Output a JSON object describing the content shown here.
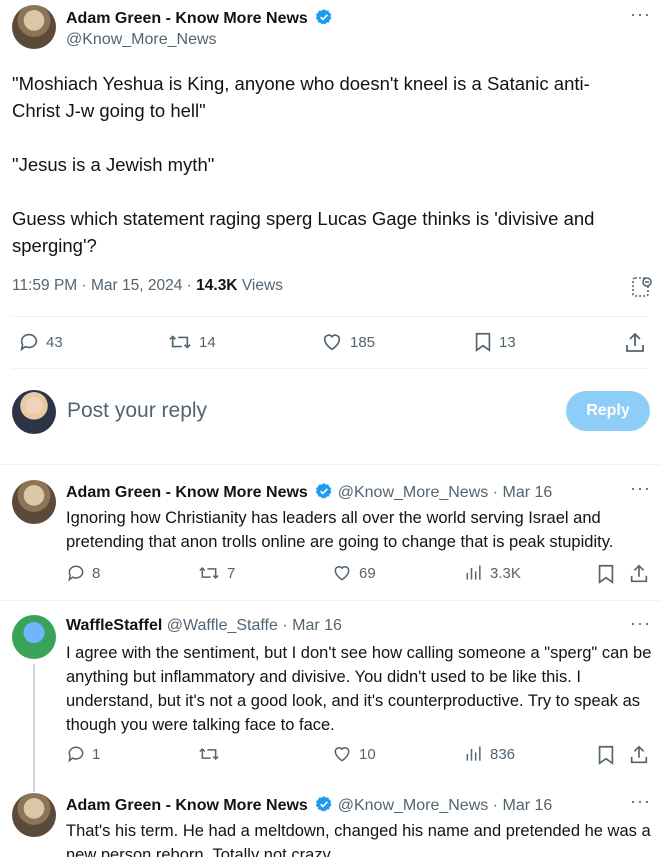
{
  "main_tweet": {
    "author_name": "Adam Green - Know More News",
    "handle": "@Know_More_News",
    "paragraphs": [
      "\"Moshiach Yeshua is King, anyone who doesn't kneel is a Satanic anti-Christ J-w going to hell\"",
      "\"Jesus is a Jewish myth\"",
      "Guess which statement raging sperg Lucas Gage thinks is 'divisive and sperging'?"
    ],
    "time": "11:59 PM",
    "date": "Mar 15, 2024",
    "views_count": "14.3K",
    "views_label": "Views",
    "replies": "43",
    "reposts": "14",
    "likes": "185",
    "bookmarks": "13"
  },
  "compose": {
    "placeholder": "Post your reply",
    "button_label": "Reply"
  },
  "replies": [
    {
      "author_name": "Adam Green - Know More News",
      "handle": "@Know_More_News",
      "date": "Mar 16",
      "text": "Ignoring how Christianity has leaders all over the world serving Israel and pretending that anon trolls online are going to change that is peak stupidity.",
      "replies": "8",
      "reposts": "7",
      "likes": "69",
      "views": "3.3K"
    },
    {
      "author_name": "WaffleStaffel",
      "handle": "@Waffle_Staffe",
      "date": "Mar 16",
      "text": "I agree with the sentiment, but I don't see how calling someone a \"sperg\" can be anything but inflammatory and divisive. You didn't used to be like this. I understand, but it's not a good look, and it's counterproductive. Try to speak as though you were talking face to face.",
      "replies": "1",
      "reposts": "",
      "likes": "10",
      "views": "836"
    },
    {
      "author_name": "Adam Green - Know More News",
      "handle": "@Know_More_News",
      "date": "Mar 16",
      "text": "That's his term. He had a meltdown, changed his name and pretended he was a new person reborn. Totally not crazy."
    }
  ],
  "separator": "·",
  "colors": {
    "verified": "#1d9bf0",
    "reply_button": "#8ecdf8",
    "muted_text": "#536471"
  }
}
